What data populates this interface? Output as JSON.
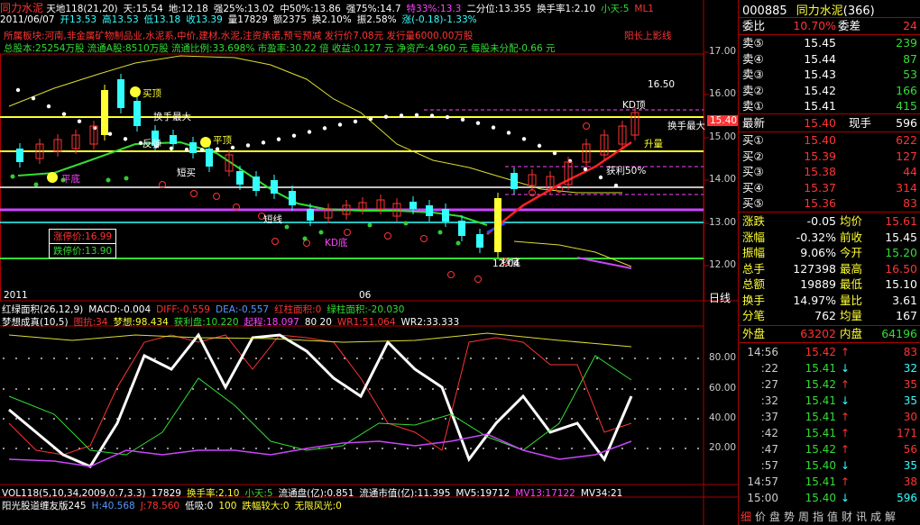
{
  "header": {
    "name": "同力水泥",
    "line1": [
      {
        "t": "天地118(21,20)",
        "c": "white"
      },
      {
        "t": "天:15.54",
        "c": "white"
      },
      {
        "t": "地:12.18",
        "c": "white"
      },
      {
        "t": "强25%:13.02",
        "c": "white"
      },
      {
        "t": "中50%:13.86",
        "c": "white"
      },
      {
        "t": "强75%:14.7",
        "c": "white"
      },
      {
        "t": "特33%:13.3",
        "c": "magenta"
      },
      {
        "t": "二分位:13.355",
        "c": "white"
      },
      {
        "t": "换手率1:2.10",
        "c": "white"
      },
      {
        "t": "小天:5",
        "c": "green"
      },
      {
        "t": "ML1",
        "c": "red"
      }
    ],
    "line2": [
      {
        "t": "2011/06/07",
        "c": "white"
      },
      {
        "t": "开13.53",
        "c": "cyan"
      },
      {
        "t": "高13.53",
        "c": "cyan"
      },
      {
        "t": "低13.18",
        "c": "cyan"
      },
      {
        "t": "收13.39",
        "c": "cyan"
      },
      {
        "t": "量17829",
        "c": "white"
      },
      {
        "t": "额2375",
        "c": "white"
      },
      {
        "t": "换2.10%",
        "c": "white"
      },
      {
        "t": "振2.58%",
        "c": "white"
      },
      {
        "t": "涨(-0.18)-1.33%",
        "c": "cyan"
      }
    ],
    "info1": "所属板块:河南,非金属矿物制品业,水泥系,中价,建材,水泥,注资承诺,预亏预减   发行价7.08元   发行量6000.00万股",
    "info1b": "阳长上影线",
    "info2": "总股本:25254万股  流通A股:8510万股  流通比例:33.698%  市盈率:30.22 倍  收益:0.127 元  净资产:4.960 元  每股未分配-0.66 元"
  },
  "chart_labels": {
    "limit_up": "涨停价:16.99",
    "limit_down": "跌停价:13.90",
    "date_left": "2011",
    "date_mid": "06",
    "period": "日线",
    "annotations": [
      {
        "t": "买顶",
        "c": "yellow"
      },
      {
        "t": "换手最大",
        "c": "white"
      },
      {
        "t": "平顶",
        "c": "yellow"
      },
      {
        "t": "短买",
        "c": "white"
      },
      {
        "t": "平底",
        "c": "magenta"
      },
      {
        "t": "升量",
        "c": "yellow"
      },
      {
        "t": "获利50%",
        "c": "white"
      },
      {
        "t": "KD顶",
        "c": "white"
      },
      {
        "t": "换手最大",
        "c": "white"
      },
      {
        "t": "16.50",
        "c": "white"
      },
      {
        "t": "反弹",
        "c": "white"
      },
      {
        "t": "12.04",
        "c": "white"
      },
      {
        "t": "15.40",
        "c": "white"
      },
      {
        "t": "短线",
        "c": "white"
      },
      {
        "t": "KD底",
        "c": "magenta"
      },
      {
        "t": "抄底",
        "c": "white"
      }
    ],
    "price_axis": [
      "17.00",
      "16.00",
      "15.00",
      "14.00",
      "13.00",
      "12.00"
    ],
    "price_box": "15.40"
  },
  "macd": {
    "items": [
      {
        "t": "红绿面积(26,12,9)",
        "c": "white"
      },
      {
        "t": "MACD:-0.004",
        "c": "white"
      },
      {
        "t": "DIFF:-0.559",
        "c": "red"
      },
      {
        "t": "DEA:-0.557",
        "c": "blue"
      },
      {
        "t": "红柱面积:0",
        "c": "red"
      },
      {
        "t": "绿柱面积:-20.030",
        "c": "green"
      }
    ]
  },
  "dream": {
    "items": [
      {
        "t": "梦想成真(10,5)",
        "c": "white"
      },
      {
        "t": "图抗:34",
        "c": "red"
      },
      {
        "t": "梦想:98.434",
        "c": "yellow"
      },
      {
        "t": "获利盘:10.220",
        "c": "green"
      },
      {
        "t": "起程:18.097",
        "c": "magenta"
      },
      {
        "t": "80 20",
        "c": "white"
      },
      {
        "t": "WR1:51.064",
        "c": "red"
      },
      {
        "t": "WR2:33.333",
        "c": "white"
      }
    ],
    "axis": [
      "80.00",
      "60.00",
      "40.00",
      "20.00"
    ]
  },
  "vol": {
    "items": [
      {
        "t": "VOL118(5,10,34,2009,0.7,3.3)",
        "c": "white"
      },
      {
        "t": "17829",
        "c": "white"
      },
      {
        "t": "换手率:2.10",
        "c": "yellow"
      },
      {
        "t": "小天:5",
        "c": "green"
      },
      {
        "t": "流通盘(亿):0.851",
        "c": "white"
      },
      {
        "t": "流通市值(亿):11.395",
        "c": "white"
      },
      {
        "t": "MV5:19712",
        "c": "white"
      },
      {
        "t": "MV13:17122",
        "c": "magenta"
      },
      {
        "t": "MV34:21",
        "c": "white"
      }
    ],
    "bottom": [
      {
        "t": "阳光股道缠友版245",
        "c": "white"
      },
      {
        "t": "H:40.568",
        "c": "blue"
      },
      {
        "t": "J:78.560",
        "c": "red"
      },
      {
        "t": "低吸:0",
        "c": "white"
      },
      {
        "t": "100",
        "c": "yellow"
      },
      {
        "t": "跌幅较大:0",
        "c": "yellow"
      },
      {
        "t": "无限风光:0",
        "c": "yellow"
      }
    ]
  },
  "panel": {
    "code": "000885",
    "name": "同力水泥",
    "count": "(366)",
    "weibi_label": "委比",
    "weibi_value": "10.70%",
    "weicha_label": "委差",
    "weicha_value": "24",
    "sells": [
      {
        "label": "卖⑤",
        "price": "15.45",
        "vol": "239"
      },
      {
        "label": "卖④",
        "price": "15.44",
        "vol": "87"
      },
      {
        "label": "卖③",
        "price": "15.43",
        "vol": "53"
      },
      {
        "label": "卖②",
        "price": "15.42",
        "vol": "166"
      },
      {
        "label": "卖①",
        "price": "15.41",
        "vol": "415"
      }
    ],
    "latest": {
      "label": "最新",
      "price": "15.40",
      "xl": "现手",
      "xv": "596"
    },
    "buys": [
      {
        "label": "买①",
        "price": "15.40",
        "vol": "622"
      },
      {
        "label": "买②",
        "price": "15.39",
        "vol": "127"
      },
      {
        "label": "买③",
        "price": "15.38",
        "vol": "44"
      },
      {
        "label": "买④",
        "price": "15.37",
        "vol": "314"
      },
      {
        "label": "买⑤",
        "price": "15.36",
        "vol": "83"
      }
    ],
    "stats": [
      {
        "l1": "涨跌",
        "v1": "-0.05",
        "c1": "white",
        "l2": "均价",
        "v2": "15.61",
        "c2": "red"
      },
      {
        "l1": "涨幅",
        "v1": "-0.32%",
        "c1": "white",
        "l2": "前收",
        "v2": "15.45",
        "c2": "white"
      },
      {
        "l1": "振幅",
        "v1": "9.06%",
        "c1": "white",
        "l2": "今开",
        "v2": "15.20",
        "c2": "green"
      },
      {
        "l1": "总手",
        "v1": "127398",
        "c1": "white",
        "l2": "最高",
        "v2": "16.50",
        "c2": "red"
      },
      {
        "l1": "总额",
        "v1": "19889",
        "c1": "white",
        "l2": "最低",
        "v2": "15.10",
        "c2": "white"
      },
      {
        "l1": "换手",
        "v1": "14.97%",
        "c1": "white",
        "l2": "量比",
        "v2": "3.61",
        "c2": "white"
      },
      {
        "l1": "分笔",
        "v1": "762",
        "c1": "white",
        "l2": "均量",
        "v2": "167",
        "c2": "white"
      }
    ],
    "outer": {
      "l1": "外盘",
      "v1": "63202",
      "l2": "内盘",
      "v2": "64196"
    },
    "ticks": [
      {
        "t": "14:56",
        "p": "15.42",
        "pc": "red",
        "a": "↑",
        "ac": "red",
        "v": "83",
        "vc": "red"
      },
      {
        "t": ":22",
        "p": "15.41",
        "pc": "green",
        "a": "↓",
        "ac": "cyan",
        "v": "32",
        "vc": "cyan"
      },
      {
        "t": ":27",
        "p": "15.42",
        "pc": "green",
        "a": "↑",
        "ac": "red",
        "v": "35",
        "vc": "red"
      },
      {
        "t": ":32",
        "p": "15.41",
        "pc": "green",
        "a": "↓",
        "ac": "cyan",
        "v": "35",
        "vc": "cyan"
      },
      {
        "t": ":37",
        "p": "15.41",
        "pc": "green",
        "a": "↑",
        "ac": "red",
        "v": "30",
        "vc": "red"
      },
      {
        "t": ":42",
        "p": "15.41",
        "pc": "green",
        "a": "↑",
        "ac": "red",
        "v": "171",
        "vc": "red"
      },
      {
        "t": ":47",
        "p": "15.42",
        "pc": "green",
        "a": "↑",
        "ac": "red",
        "v": "56",
        "vc": "red"
      },
      {
        "t": ":57",
        "p": "15.40",
        "pc": "green",
        "a": "↓",
        "ac": "cyan",
        "v": "35",
        "vc": "cyan"
      },
      {
        "t": "14:57",
        "p": "15.41",
        "pc": "green",
        "a": "↑",
        "ac": "red",
        "v": "38",
        "vc": "red"
      },
      {
        "t": "15:00",
        "p": "15.40",
        "pc": "green",
        "a": "↓",
        "ac": "cyan",
        "v": "596",
        "vc": "cyan"
      }
    ],
    "tabs": [
      "细",
      "价",
      "盘",
      "势",
      "周",
      "指",
      "值",
      "财",
      "讯",
      "成",
      "解"
    ]
  },
  "colors": {
    "up": "#ff3333",
    "down": "#33dd33",
    "bg": "#000000",
    "frame": "#aa0000",
    "accent": "#ffff33"
  }
}
